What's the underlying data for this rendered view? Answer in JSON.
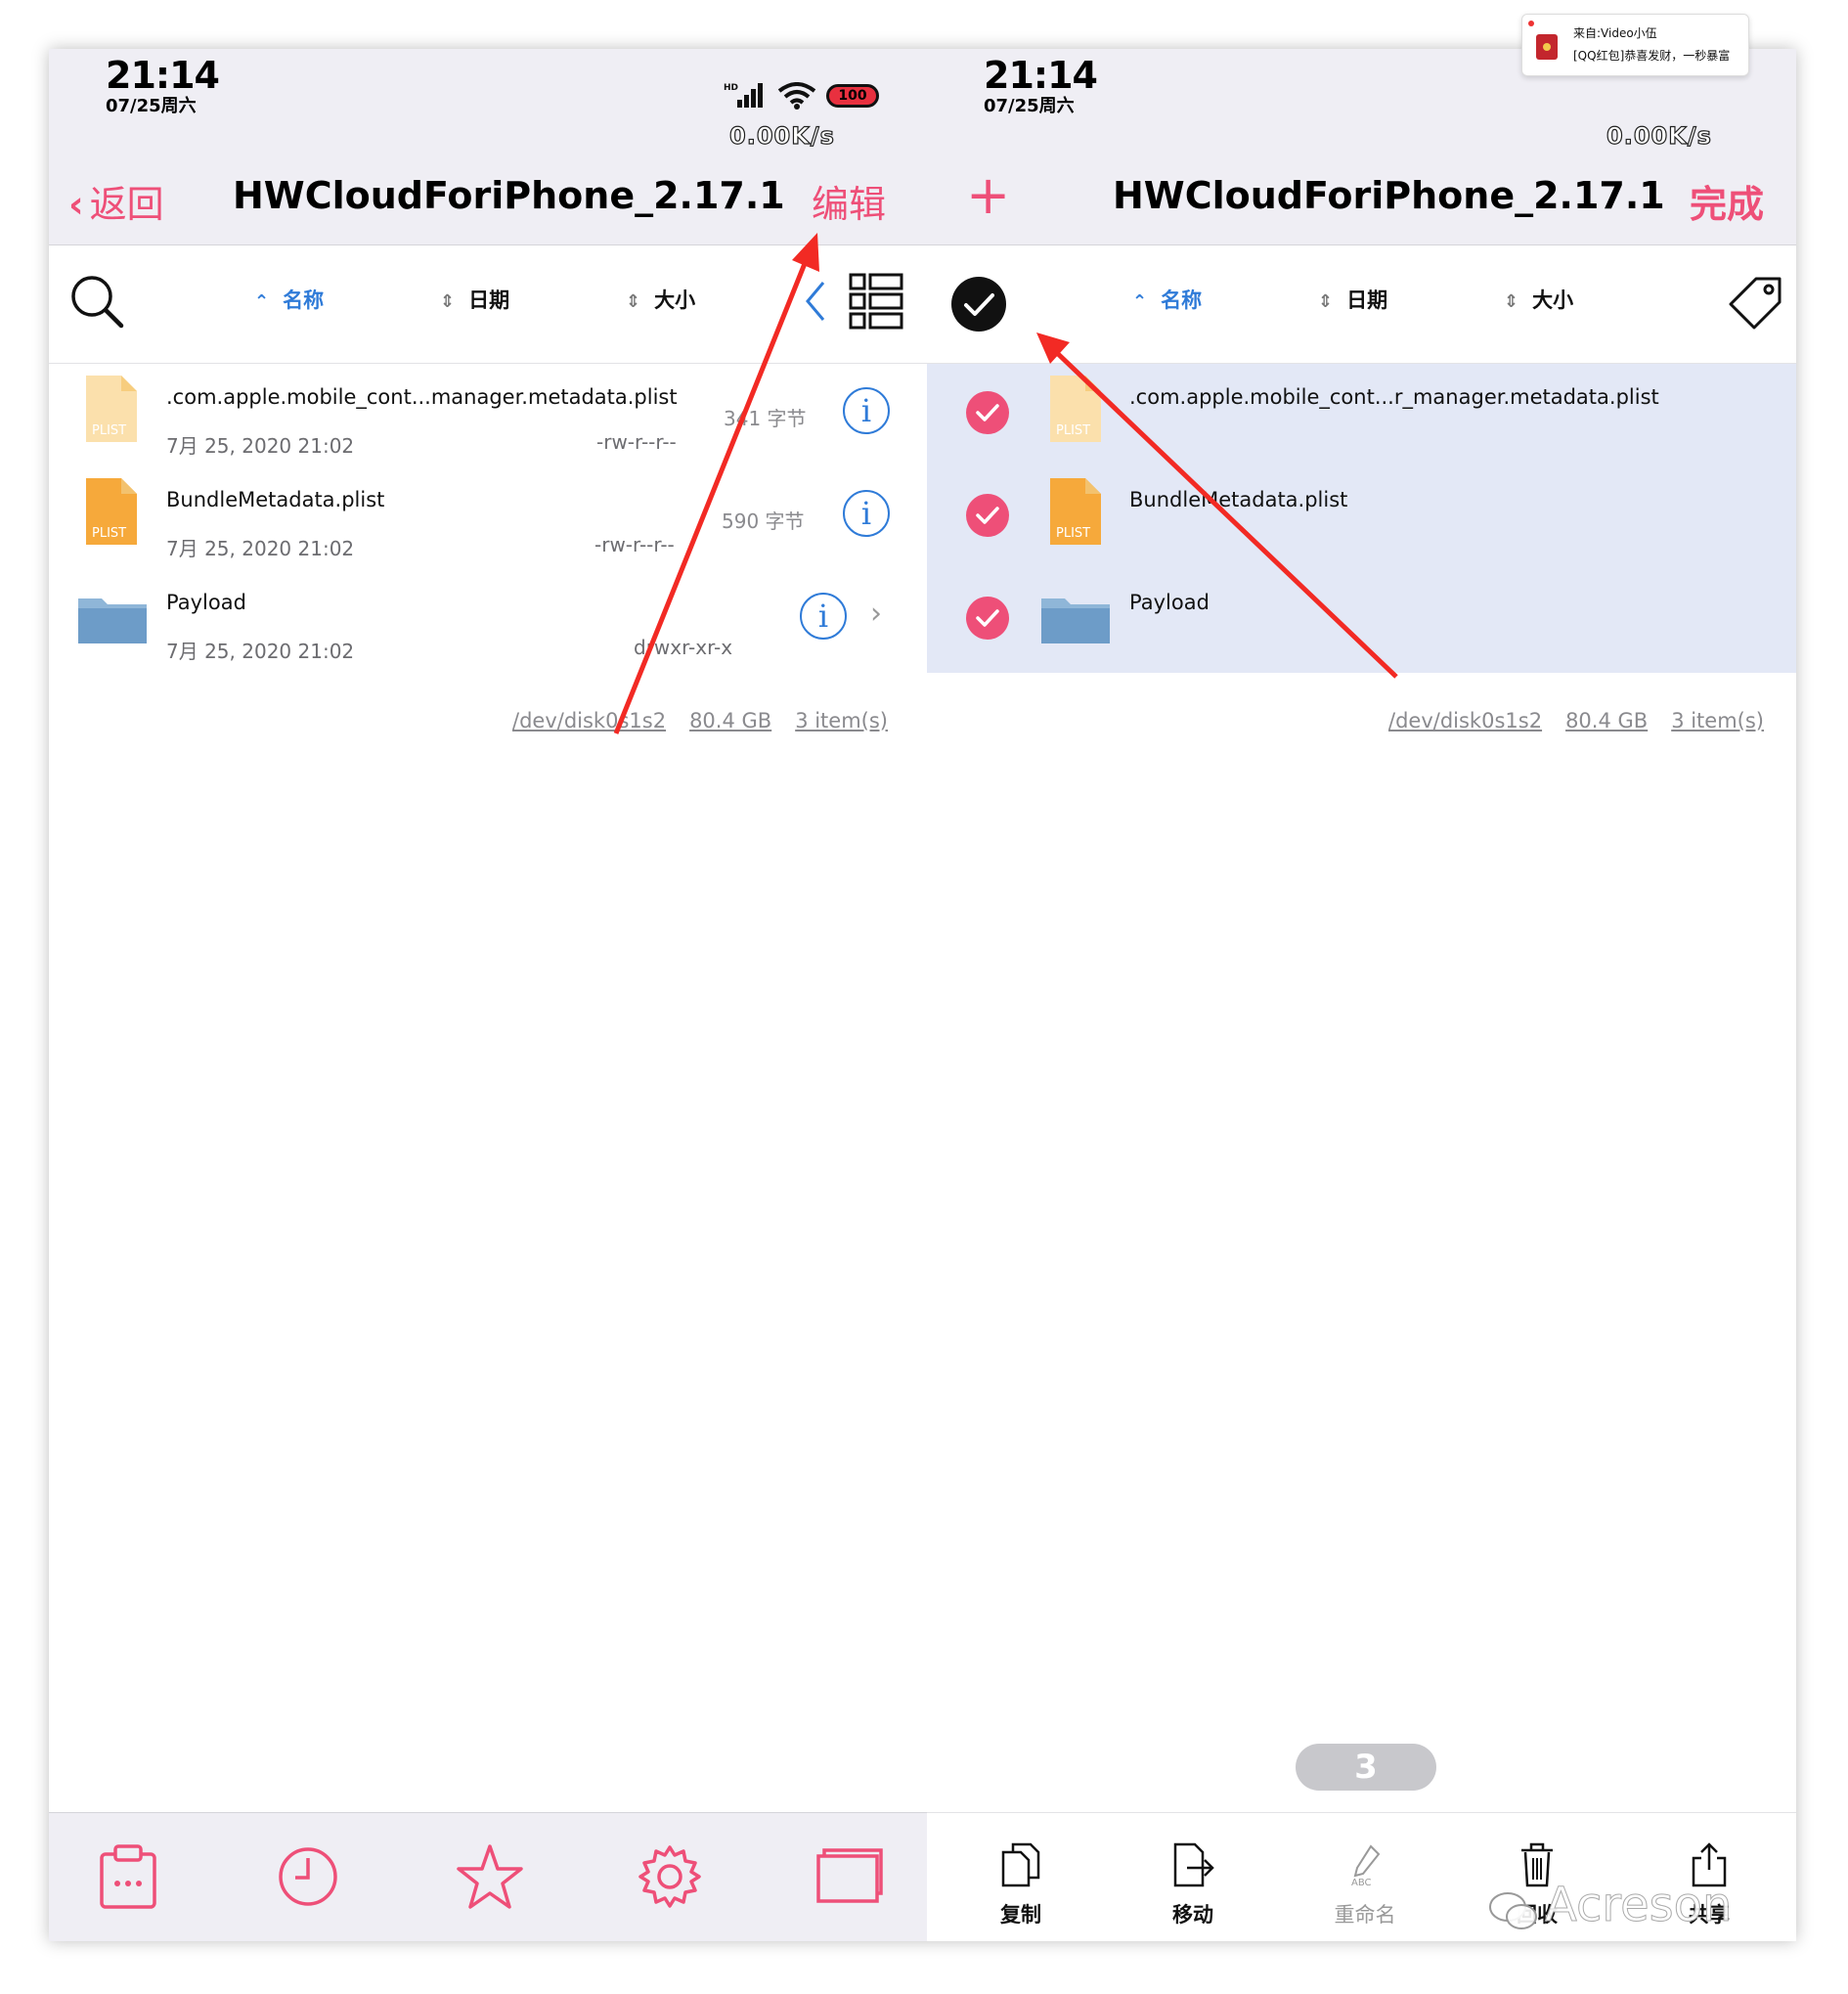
{
  "left": {
    "status": {
      "time": "21:14",
      "date": "07/25周六",
      "speed": "0.00K/s",
      "battery": "100",
      "network": "HD"
    },
    "nav": {
      "back_label": "返回",
      "title": "HWCloudForiPhone_2.17.1",
      "edit_label": "编辑"
    },
    "sort": {
      "name": "名称",
      "date": "日期",
      "size": "大小"
    },
    "files": [
      {
        "name": ".com.apple.mobile_cont...manager.metadata.plist",
        "date": "7月 25, 2020 21:02",
        "perm": "-rw-r--r--",
        "size": "341 字节",
        "icon": "plist-file-icon"
      },
      {
        "name": "BundleMetadata.plist",
        "date": "7月 25, 2020 21:02",
        "perm": "-rw-r--r--",
        "size": "590 字节",
        "icon": "plist-file-icon"
      },
      {
        "name": "Payload",
        "date": "7月 25, 2020 21:02",
        "perm": "drwxr-xr-x",
        "size": "",
        "icon": "folder-icon"
      }
    ],
    "footer": {
      "disk": "/dev/disk0s1s2",
      "space": "80.4 GB",
      "items": "3 item(s)"
    },
    "tabbar": [
      "clipboard-icon",
      "clock-icon",
      "star-icon",
      "gear-icon",
      "windows-icon"
    ]
  },
  "right": {
    "status": {
      "time": "21:14",
      "date": "07/25周六",
      "speed": "0.00K/s"
    },
    "notification": {
      "line1": "来自:Video小伍",
      "line2": "[QQ红包]恭喜发财，一秒暴富"
    },
    "nav": {
      "add_label": "+",
      "title": "HWCloudForiPhone_2.17.1",
      "done_label": "完成"
    },
    "sort": {
      "name": "名称",
      "date": "日期",
      "size": "大小"
    },
    "files": [
      {
        "name": ".com.apple.mobile_cont...r_manager.metadata.plist",
        "selected": true
      },
      {
        "name": "BundleMetadata.plist",
        "selected": true
      },
      {
        "name": "Payload",
        "selected": true
      }
    ],
    "footer": {
      "disk": "/dev/disk0s1s2",
      "space": "80.4 GB",
      "items": "3 item(s)"
    },
    "selected_count": "3",
    "actions": {
      "copy": "复制",
      "move": "移动",
      "rename": "重命名",
      "recycle": "回收",
      "share": "共享"
    }
  },
  "watermark": "Acreson",
  "colors": {
    "accent_pink": "#ee4f78",
    "accent_blue": "#2f7bd8",
    "annotation_red": "#f22a24",
    "bar_bg": "#efeef4",
    "selection_bg": "#e3e8f6"
  }
}
